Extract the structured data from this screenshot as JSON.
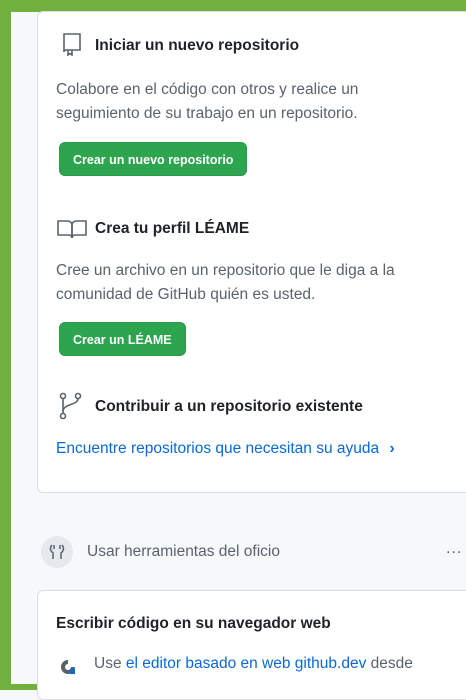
{
  "new_repo": {
    "title": "Iniciar un nuevo repositorio",
    "description": "Colabore en el código con otros y realice un seguimiento de su trabajo en un repositorio.",
    "button": "Crear un nuevo repositorio",
    "icon": "repo-icon"
  },
  "readme": {
    "title": "Crea tu perfil LÉAME",
    "description": "Cree un archivo en un repositorio que le diga a la comunidad de GitHub quién es usted.",
    "button": "Crear un LÉAME",
    "icon": "book-icon"
  },
  "contribute": {
    "title": "Contribuir a un repositorio existente",
    "link": "Encuentre repositorios que necesitan su ayuda",
    "chevron": "›",
    "icon": "git-fork-icon"
  },
  "tools_section": {
    "title": "Usar herramientas del oficio",
    "more": "...",
    "icon": "tools-icon"
  },
  "web_editor": {
    "title": "Escribir código en su navegador web",
    "prefix": "Use",
    "link": "el editor basado en web github.dev",
    "suffix": "desde",
    "icon": "codespaces-icon"
  },
  "colors": {
    "frame": "#6fb13c",
    "button": "#2da44e",
    "link": "#0969da"
  }
}
